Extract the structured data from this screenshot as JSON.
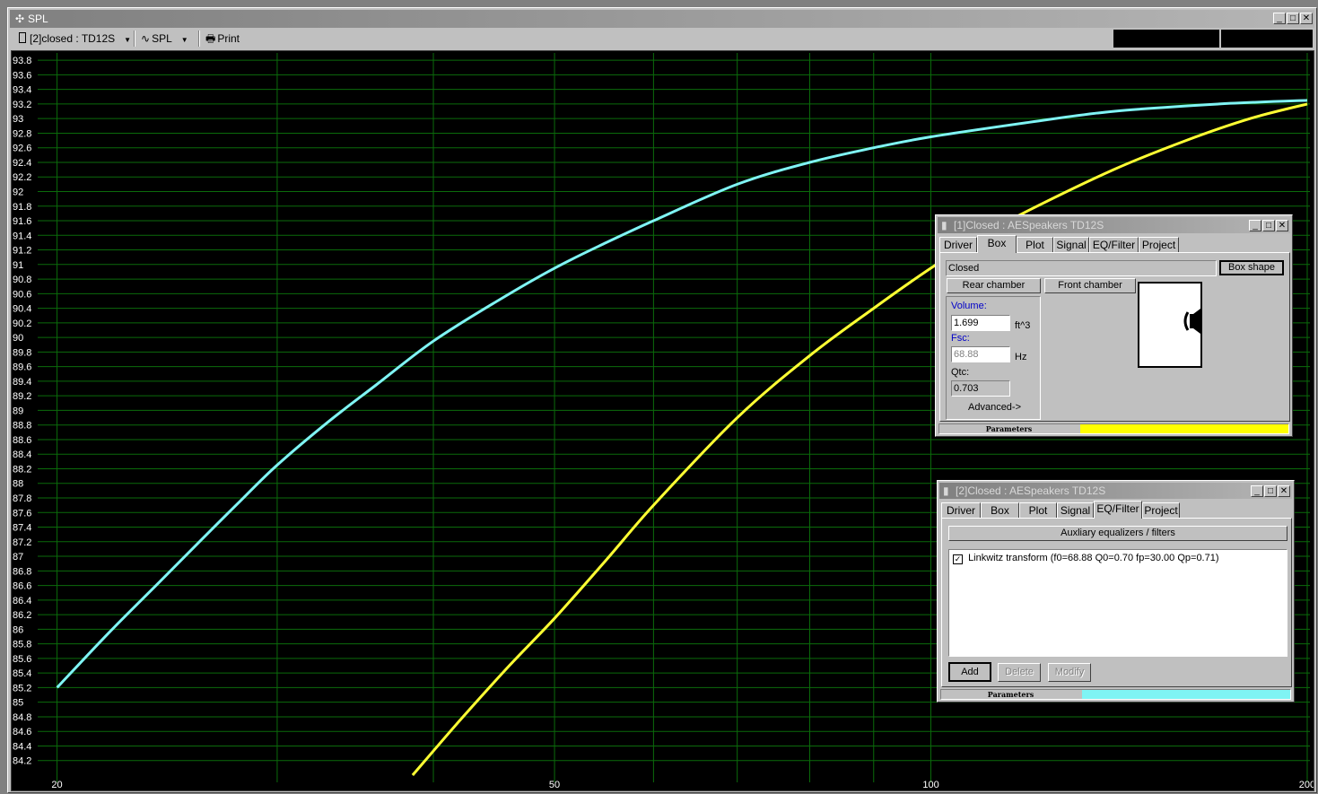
{
  "main": {
    "title": "SPL",
    "toolbar": {
      "project_select": "[2]closed : TD12S",
      "view_select": "SPL",
      "print_label": "Print"
    }
  },
  "colors": {
    "curve1": "#ffff33",
    "curve2": "#7ff4f4",
    "grid": "#0b6b0b",
    "background": "#000000"
  },
  "chart_data": {
    "type": "line",
    "xscale": "log",
    "xlim": [
      19.3,
      201
    ],
    "ylim": [
      84.0,
      93.9
    ],
    "x_ticks": [
      20,
      50,
      100,
      200
    ],
    "y_ticks": [
      84.2,
      84.4,
      84.6,
      84.8,
      85,
      85.2,
      85.4,
      85.6,
      85.8,
      86,
      86.2,
      86.4,
      86.6,
      86.8,
      87,
      87.2,
      87.4,
      87.6,
      87.8,
      88,
      88.2,
      88.4,
      88.6,
      88.8,
      89,
      89.2,
      89.4,
      89.6,
      89.8,
      90,
      90.2,
      90.4,
      90.6,
      90.8,
      91,
      91.2,
      91.4,
      91.6,
      91.8,
      92,
      92.2,
      92.4,
      92.6,
      92.8,
      93,
      93.2,
      93.4,
      93.6,
      93.8
    ],
    "x_gridlines": [
      20,
      30,
      40,
      50,
      60,
      70,
      80,
      90,
      100,
      200
    ],
    "series": [
      {
        "color": "#ffff33",
        "points": [
          [
            38.5,
            84.0
          ],
          [
            42,
            84.75
          ],
          [
            46,
            85.5
          ],
          [
            50,
            86.15
          ],
          [
            55,
            86.95
          ],
          [
            60,
            87.7
          ],
          [
            70,
            88.9
          ],
          [
            80,
            89.75
          ],
          [
            90,
            90.4
          ],
          [
            100,
            90.95
          ],
          [
            110,
            91.4
          ],
          [
            120,
            91.75
          ],
          [
            140,
            92.3
          ],
          [
            160,
            92.7
          ],
          [
            180,
            93.0
          ],
          [
            200,
            93.2
          ]
        ]
      },
      {
        "color": "#7ff4f4",
        "points": [
          [
            20,
            85.2
          ],
          [
            22,
            85.95
          ],
          [
            24,
            86.6
          ],
          [
            26,
            87.2
          ],
          [
            28,
            87.75
          ],
          [
            30,
            88.25
          ],
          [
            33,
            88.85
          ],
          [
            36,
            89.35
          ],
          [
            40,
            89.95
          ],
          [
            45,
            90.5
          ],
          [
            50,
            90.95
          ],
          [
            55,
            91.3
          ],
          [
            60,
            91.6
          ],
          [
            70,
            92.1
          ],
          [
            80,
            92.4
          ],
          [
            90,
            92.6
          ],
          [
            100,
            92.75
          ],
          [
            120,
            92.95
          ],
          [
            140,
            93.1
          ],
          [
            170,
            93.2
          ],
          [
            200,
            93.25
          ]
        ]
      }
    ]
  },
  "window1": {
    "title": "[1]Closed : AESpeakers TD12S",
    "tabs": [
      "Driver",
      "Box",
      "Plot",
      "Signal",
      "EQ/Filter",
      "Project"
    ],
    "box_type": "Closed",
    "box_shape_button": "Box shape",
    "rear_chamber": "Rear chamber",
    "front_chamber": "Front chamber",
    "volume_label": "Volume:",
    "volume_value": "1.699",
    "volume_unit": "ft^3",
    "fsc_label": "Fsc:",
    "fsc_value": "68.88",
    "fsc_unit": "Hz",
    "qtc_label": "Qtc:",
    "qtc_value": "0.703",
    "advanced": "Advanced->",
    "status_label": "Parameters",
    "status_color": "#ffff00"
  },
  "window2": {
    "title": "[2]Closed : AESpeakers TD12S",
    "tabs": [
      "Driver",
      "Box",
      "Plot",
      "Signal",
      "EQ/Filter",
      "Project"
    ],
    "aux_header": "Auxliary equalizers / filters",
    "filter_item": "Linkwitz transform (f0=68.88 Q0=0.70 fp=30.00 Qp=0.71)",
    "add": "Add",
    "delete": "Delete",
    "modify": "Modify",
    "status_label": "Parameters",
    "status_color": "#7ff4f4"
  }
}
